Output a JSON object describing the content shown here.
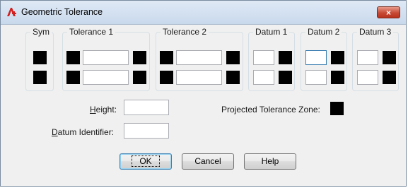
{
  "window": {
    "title": "Geometric Tolerance",
    "close_glyph": "×",
    "app_icon": "autocad-icon"
  },
  "groups": {
    "sym": "Sym",
    "tolerance1": "Tolerance 1",
    "tolerance2": "Tolerance 2",
    "datum1": "Datum 1",
    "datum2": "Datum 2",
    "datum3": "Datum 3"
  },
  "fields": {
    "height_label_accel": "H",
    "height_label_rest": "eight:",
    "height_value": "",
    "datum_id_label_accel": "D",
    "datum_id_label_rest": "atum Identifier:",
    "datum_id_value": "",
    "projected_zone_label": "Projected Tolerance Zone:"
  },
  "buttons": {
    "ok": "OK",
    "cancel": "Cancel",
    "help": "Help"
  },
  "colors": {
    "swatch": "#000000",
    "focus_border": "#3c7fb1"
  }
}
